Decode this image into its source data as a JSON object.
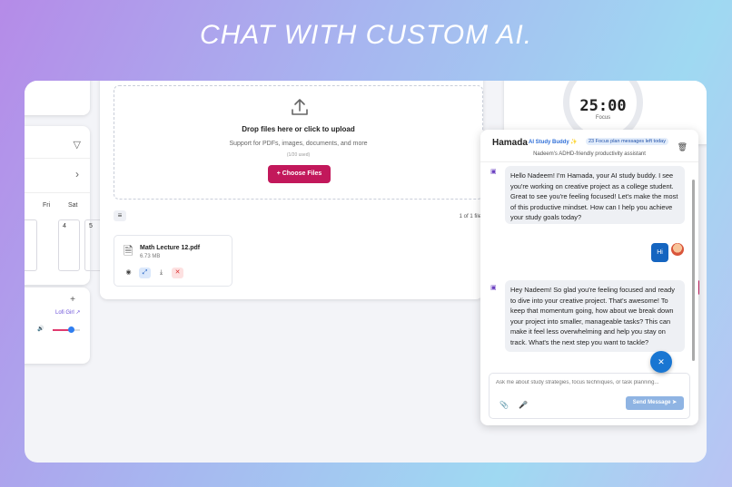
{
  "hero": {
    "title": "CHAT WITH CUSTOM AI."
  },
  "calendar": {
    "days": [
      "Fri",
      "Sat"
    ],
    "dates": [
      "4",
      "5"
    ]
  },
  "music": {
    "source_link": "Lofi Girl ↗",
    "volume_fraction": 0.65
  },
  "upload": {
    "title": "Drop files here or click to upload",
    "support": "Support for PDFs, images, documents, and more",
    "usage": "(1/20 used)",
    "choose_label": "+  Choose Files",
    "pager": "1 of 1 file",
    "file": {
      "name": "Math Lecture 12.pdf",
      "size": "6.73 MB"
    }
  },
  "timer": {
    "value": "25:00",
    "mode": "Focus"
  },
  "chat": {
    "name": "Hamada",
    "role": "AI Study Buddy ✨",
    "badge": "23 Focus plan messages left today",
    "subtitle": "Nadeem's ADHD-friendly productivity assistant",
    "messages": [
      {
        "from": "ai",
        "text": "Hello Nadeem! I'm Hamada, your AI study buddy. I see you're working on creative project as a college student. Great to see you're feeling focused! Let's make the most of this productive mindset. How can I help you achieve your study goals today?"
      },
      {
        "from": "user",
        "text": "Hi"
      },
      {
        "from": "ai",
        "text": "Hey Nadeem! So glad you're feeling focused and ready to dive into your creative project. That's awesome! To keep that momentum going, how about we break down your project into smaller, manageable tasks? This can make it feel less overwhelming and help you stay on track. What's the next step you want to tackle?"
      }
    ],
    "input_placeholder": "Ask me about study strategies, focus techniques, or task planning...",
    "send_label": "Send Message ➤"
  },
  "colors": {
    "accent": "#c2185b",
    "primary": "#1976d2",
    "send_disabled": "#8fb4e3"
  }
}
